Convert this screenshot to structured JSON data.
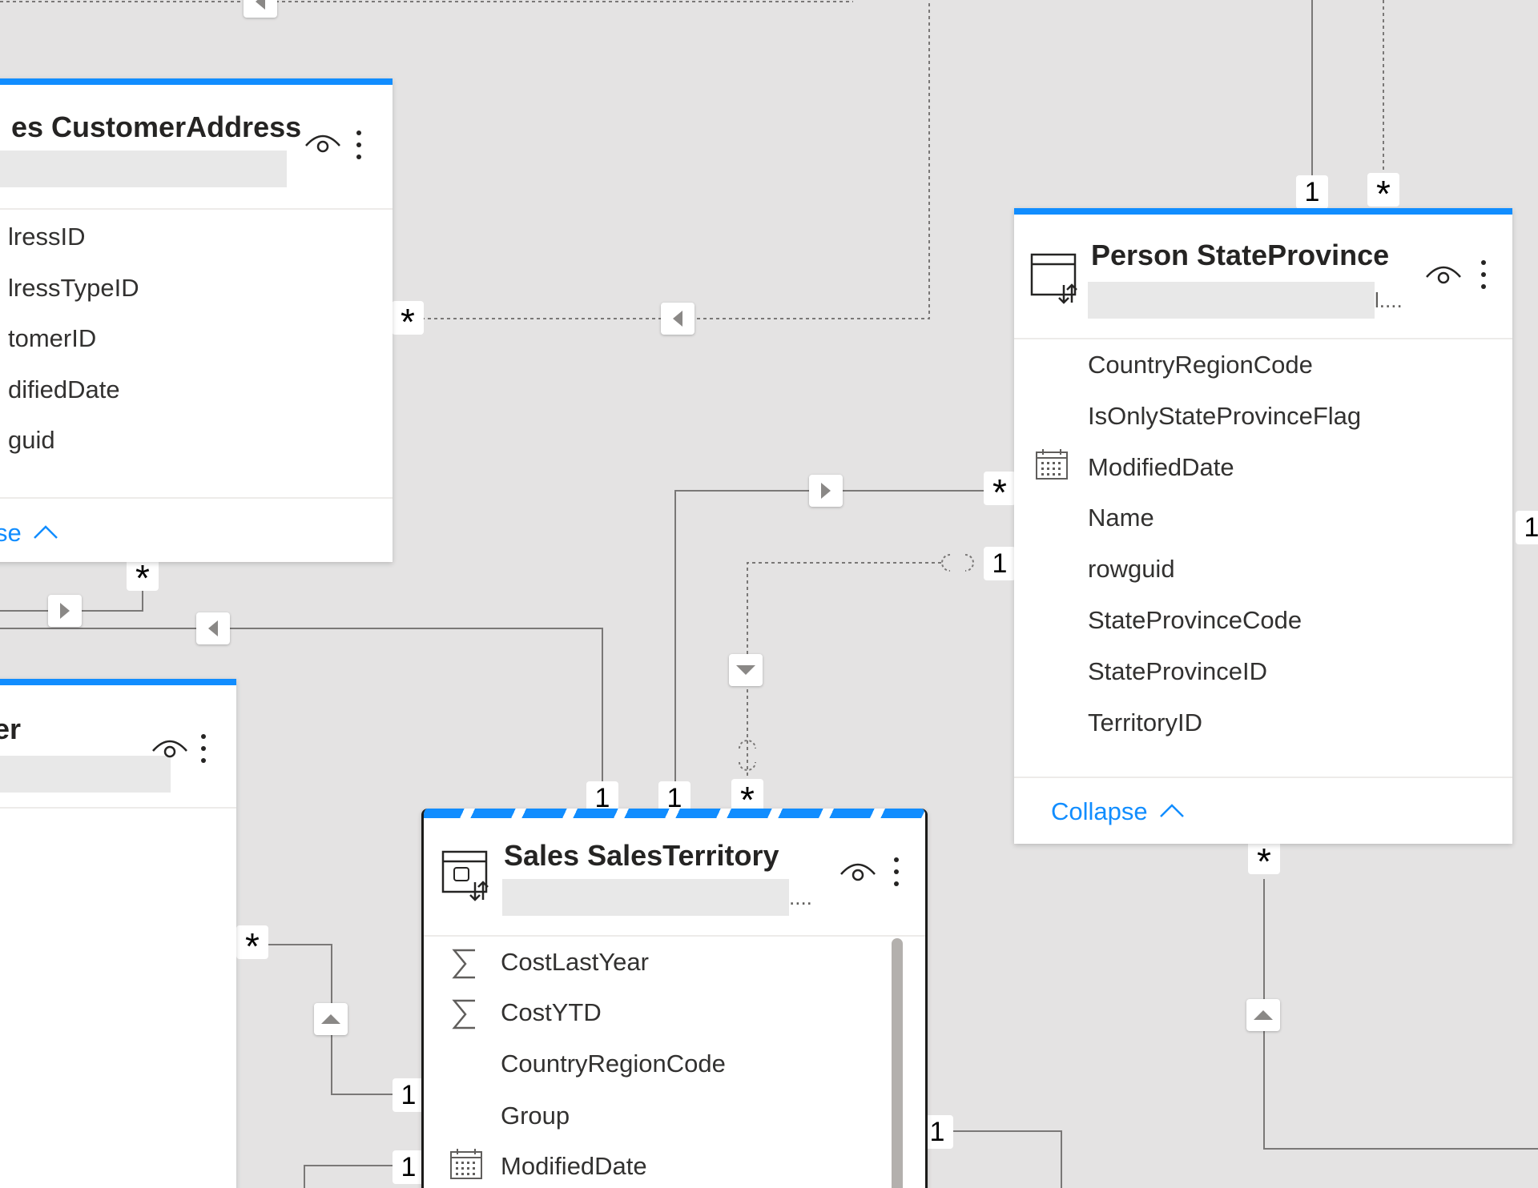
{
  "tables": {
    "customer_address": {
      "title": "es CustomerAddress",
      "fields": [
        "lressID",
        "lressTypeID",
        "tomerID",
        "difiedDate",
        "guid"
      ],
      "collapse_label": "se"
    },
    "partial_table": {
      "title": "er"
    },
    "state_province": {
      "title": "Person StateProvince",
      "description_ellipsis": "l....",
      "fields": [
        "CountryRegionCode",
        "IsOnlyStateProvinceFlag",
        "ModifiedDate",
        "Name",
        "rowguid",
        "StateProvinceCode",
        "StateProvinceID",
        "TerritoryID"
      ],
      "field_icons": [
        "",
        "",
        "calendar-icon",
        "",
        "",
        "",
        "",
        ""
      ],
      "collapse_label": "Collapse"
    },
    "sales_territory": {
      "title": "Sales SalesTerritory",
      "description_ellipsis": "....",
      "fields": [
        "CostLastYear",
        "CostYTD",
        "CountryRegionCode",
        "Group",
        "ModifiedDate"
      ],
      "field_icons": [
        "sigma-icon",
        "sigma-icon",
        "",
        "",
        "calendar-icon"
      ]
    }
  },
  "cardinality": {
    "one": "1",
    "many": "*"
  },
  "colors": {
    "accent": "#118dff",
    "canvas": "#e4e3e3",
    "line": "#7a7877"
  }
}
